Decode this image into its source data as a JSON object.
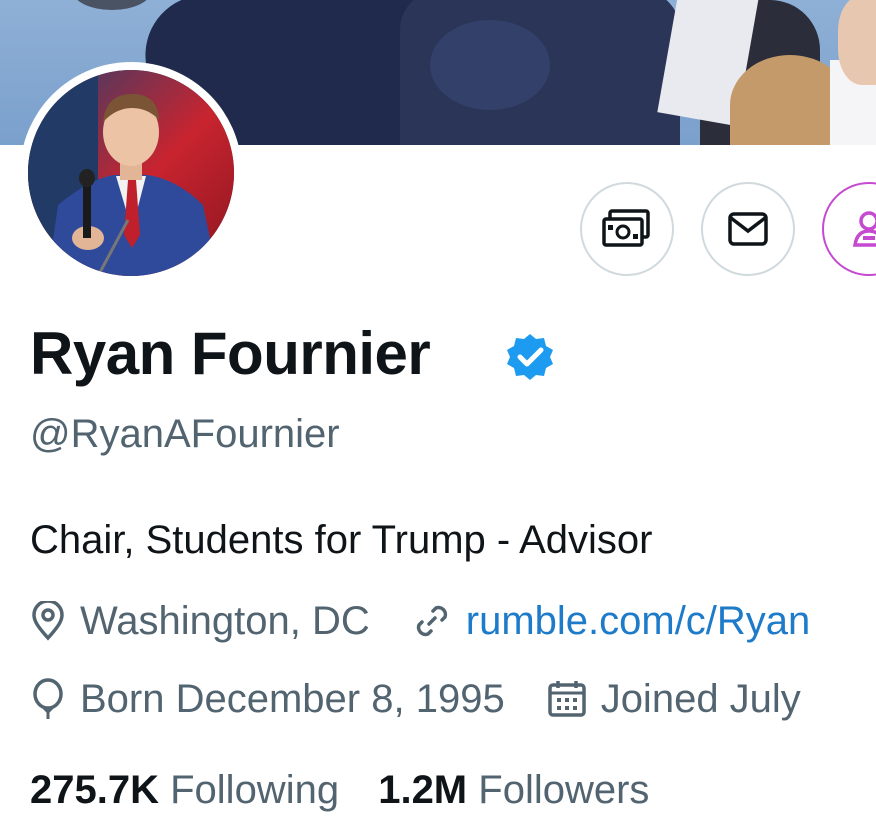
{
  "profile": {
    "name": "Ryan Fournier",
    "handle": "@RyanAFournier",
    "bio": "Chair, Students for Trump - Advisor",
    "location": "Washington, DC",
    "website": "rumble.com/c/Ryan",
    "birthday": "Born December 8, 1995",
    "joined": "Joined July"
  },
  "stats": {
    "following_count": "275.7K",
    "following_label": "Following",
    "followers_count": "1.2M",
    "followers_label": "Followers"
  },
  "icons": {
    "tip": "tip-money-icon",
    "message": "envelope-icon",
    "subscribe": "subscribe-person-icon",
    "verified": "verified-badge-icon",
    "location": "location-pin-icon",
    "link": "link-icon",
    "birthday": "balloon-icon",
    "calendar": "calendar-icon"
  },
  "colors": {
    "verified_blue": "#1d9bf0",
    "link_blue": "#1d7bc9",
    "secondary_text": "#536471",
    "subscribe_accent": "#c54ad1"
  }
}
